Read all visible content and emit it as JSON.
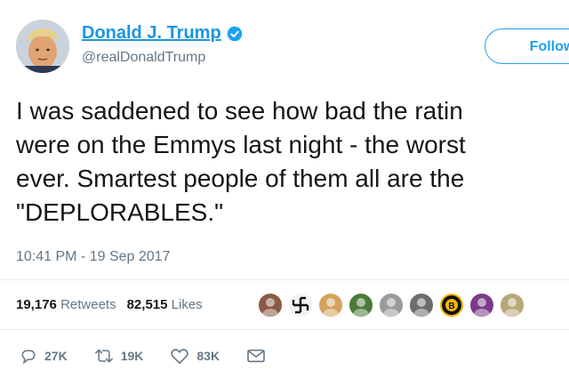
{
  "author": {
    "name": "Donald J. Trump",
    "handle": "@realDonaldTrump",
    "verified": true
  },
  "follow_label": "Follow",
  "tweet": {
    "lines": [
      "I was saddened to see how bad the ratin",
      "were on the Emmys last night - the worst",
      "ever. Smartest people of them all are the",
      "\"DEPLORABLES.\""
    ],
    "timestamp": "10:41 PM - 19 Sep 2017"
  },
  "stats": {
    "retweets_count": "19,176",
    "retweets_label": "Retweets",
    "likes_count": "82,515",
    "likes_label": "Likes"
  },
  "liker_avatars": [
    {
      "icon": "profile-avatar",
      "color": "#8a5a44"
    },
    {
      "icon": "swastika-avatar",
      "color": "#f2f2f2"
    },
    {
      "icon": "profile-avatar",
      "color": "#d4a25c"
    },
    {
      "icon": "profile-avatar",
      "color": "#4a7a3a"
    },
    {
      "icon": "profile-avatar",
      "color": "#9a9a9a"
    },
    {
      "icon": "profile-avatar",
      "color": "#6c6c6c"
    },
    {
      "icon": "bruins-logo-avatar",
      "color": "#f5b800"
    },
    {
      "icon": "profile-avatar",
      "color": "#7a3a8a"
    },
    {
      "icon": "profile-avatar",
      "color": "#b8a878"
    }
  ],
  "actions": {
    "reply_count": "27K",
    "retweet_count": "19K",
    "like_count": "83K"
  },
  "colors": {
    "accent": "#1da1f2",
    "link": "#1b95e0",
    "muted": "#657786"
  }
}
